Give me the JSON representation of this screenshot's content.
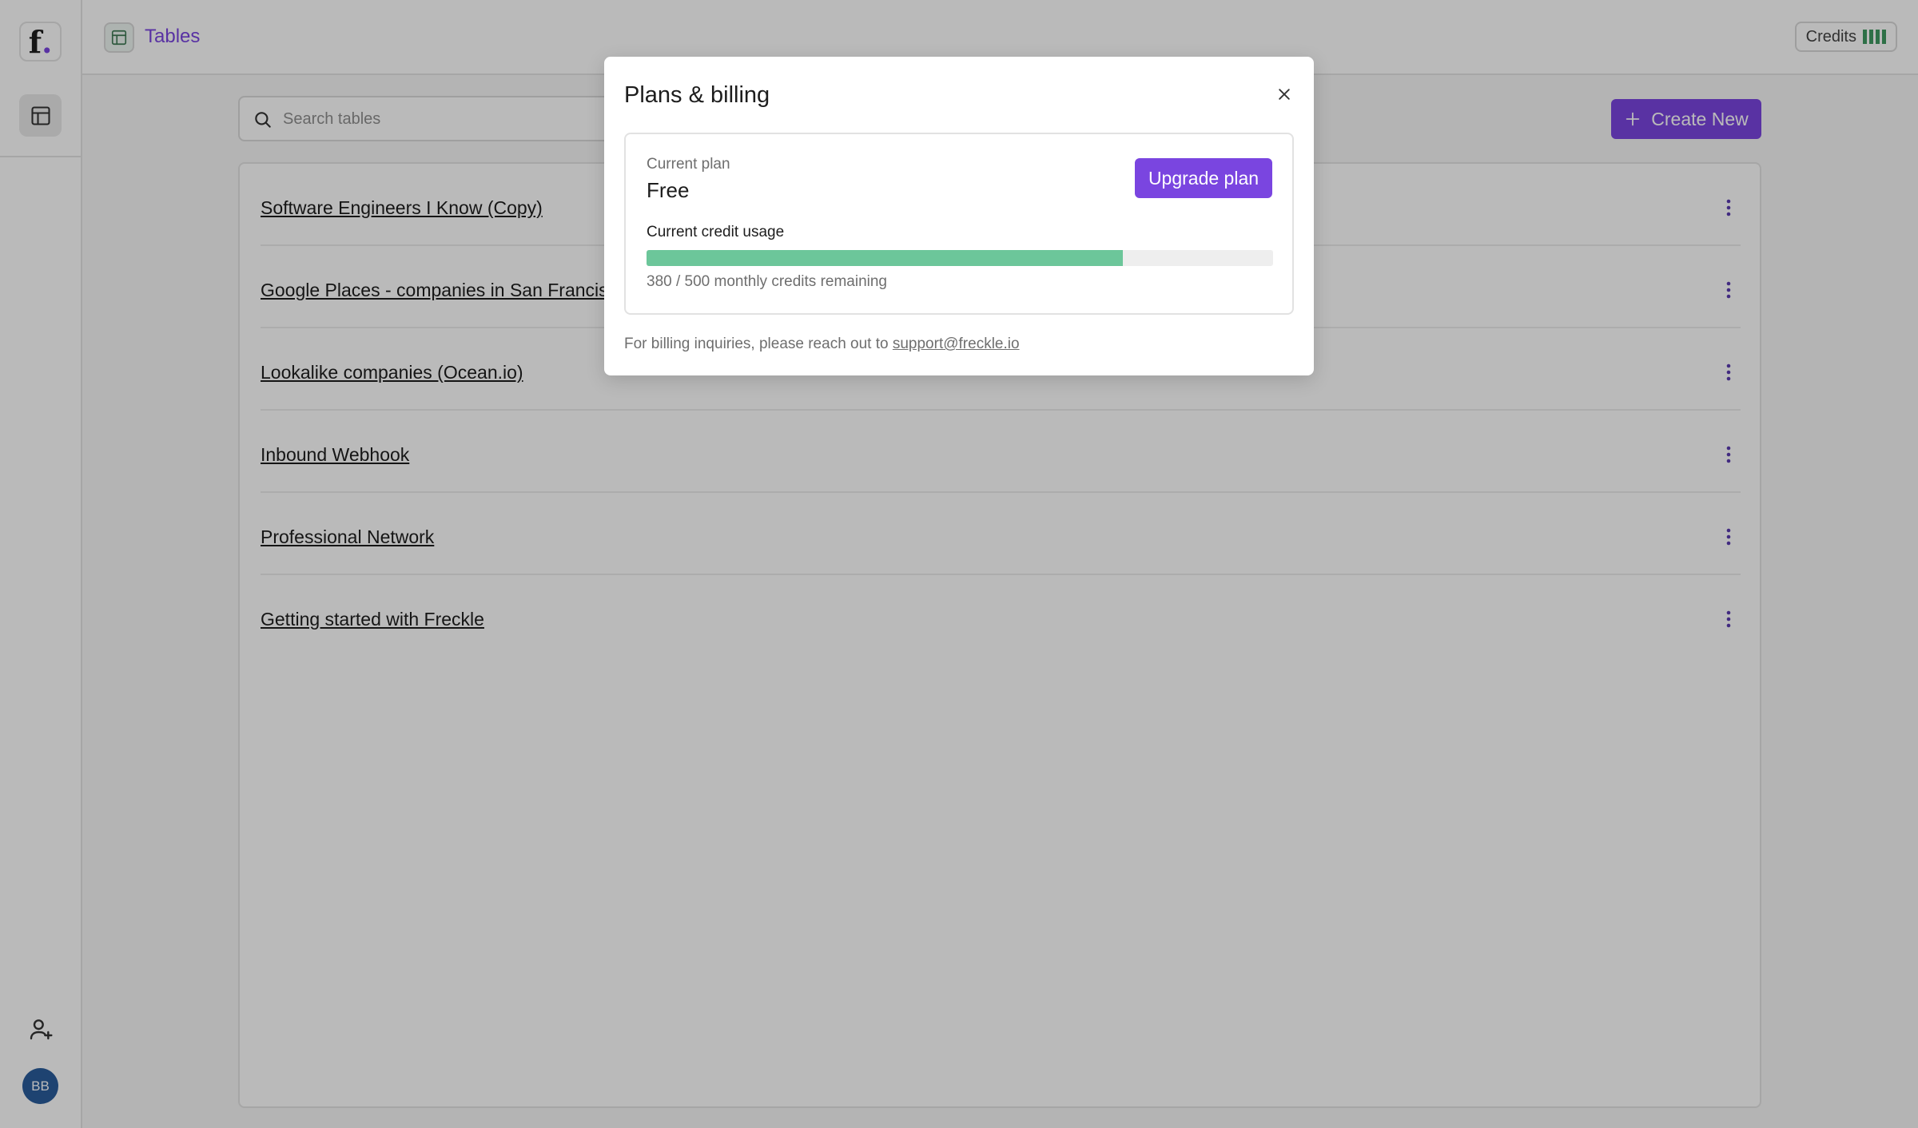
{
  "sidebar": {
    "logo_letter": "f",
    "logo_dot": ".",
    "avatar_initials": "BB"
  },
  "header": {
    "title": "Tables",
    "credits_label": "Credits",
    "accent_color": "#7a45e0"
  },
  "main": {
    "search_placeholder": "Search tables",
    "create_label": "Create New",
    "rows": [
      {
        "title": "Software Engineers I Know (Copy)"
      },
      {
        "title": "Google Places - companies in San Francisco"
      },
      {
        "title": "Lookalike companies (Ocean.io)"
      },
      {
        "title": "Inbound Webhook"
      },
      {
        "title": "Professional Network"
      },
      {
        "title": "Getting started with Freckle"
      }
    ]
  },
  "modal": {
    "title": "Plans & billing",
    "current_plan_label": "Current plan",
    "current_plan_value": "Free",
    "upgrade_label": "Upgrade plan",
    "usage_label": "Current credit usage",
    "usage_text": "380 / 500 monthly credits remaining",
    "usage_fraction": 0.76,
    "usage_color": "#6cc69a",
    "billing_prefix": "For billing inquiries, please reach out to ",
    "billing_email": "support@freckle.io"
  }
}
